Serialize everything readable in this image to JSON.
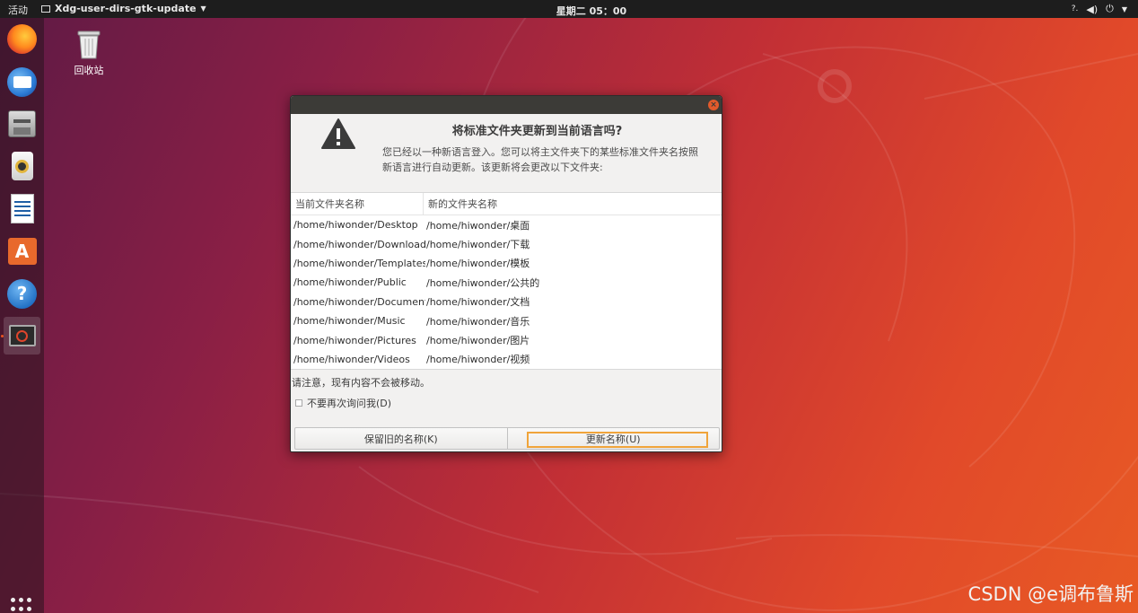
{
  "topbar": {
    "activities": "活动",
    "app_name": "Xdg-user-dirs-gtk-update",
    "clock": "星期二 05：00"
  },
  "dock": {
    "items": [
      "firefox-icon",
      "thunderbird-icon",
      "files-icon",
      "rhythmbox-icon",
      "libreoffice-writer-icon",
      "software-center-icon",
      "help-icon",
      "terminal-icon"
    ]
  },
  "desktop": {
    "trash_label": "回收站"
  },
  "dialog": {
    "title": "将标准文件夹更新到当前语言吗?",
    "message_line1": "您已经以一种新语言登入。您可以将主文件夹下的某些标准文件夹名按照",
    "message_line2": "新语言进行自动更新。该更新将会更改以下文件夹:",
    "columns": [
      "当前文件夹名称",
      "新的文件夹名称"
    ],
    "rows": [
      [
        "/home/hiwonder/Desktop",
        "/home/hiwonder/桌面"
      ],
      [
        "/home/hiwonder/Downloads",
        "/home/hiwonder/下载"
      ],
      [
        "/home/hiwonder/Templates",
        "/home/hiwonder/模板"
      ],
      [
        "/home/hiwonder/Public",
        "/home/hiwonder/公共的"
      ],
      [
        "/home/hiwonder/Documents",
        "/home/hiwonder/文档"
      ],
      [
        "/home/hiwonder/Music",
        "/home/hiwonder/音乐"
      ],
      [
        "/home/hiwonder/Pictures",
        "/home/hiwonder/图片"
      ],
      [
        "/home/hiwonder/Videos",
        "/home/hiwonder/视频"
      ]
    ],
    "note": "请注意，现有内容不会被移动。",
    "dont_ask": "不要再次询问我(D)",
    "keep_button": "保留旧的名称(K)",
    "update_button": "更新名称(U)"
  },
  "watermark": "CSDN @e调布鲁斯",
  "colors": {
    "accent": "#e95420",
    "focus": "#f0a43a",
    "titlebar": "#3c3b37"
  }
}
